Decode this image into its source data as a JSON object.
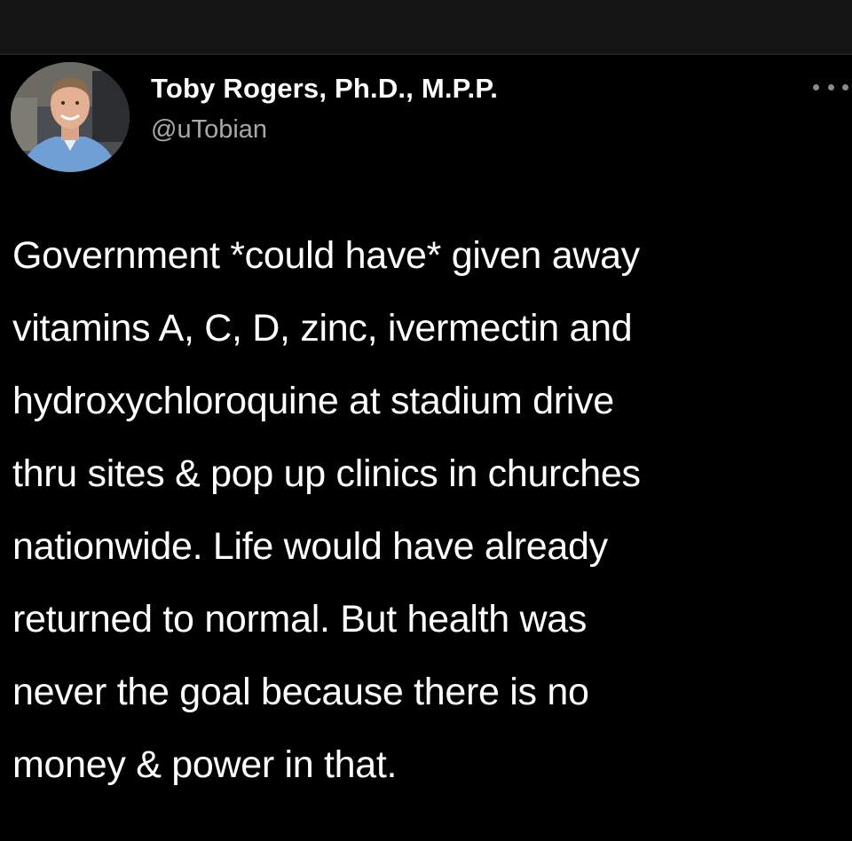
{
  "colors": {
    "background": "#000000",
    "top_bar": "#141414",
    "text_primary": "#ffffff",
    "text_secondary": "#a8a8a8",
    "icon_gray": "#8a8a8a"
  },
  "tweet": {
    "author": {
      "name": "Toby Rogers, Ph.D., M.P.P.",
      "handle": "@uTobian",
      "avatar_icon": "profile-photo"
    },
    "more_icon": "ellipsis-icon",
    "text": "Government *could have* given away\nvitamins A, C, D, zinc, ivermectin and\nhydroxychloroquine at stadium drive\nthru sites & pop up clinics in churches\nnationwide. Life would have already\nreturned to normal. But health was\nnever the goal because there is no\nmoney & power in that."
  }
}
